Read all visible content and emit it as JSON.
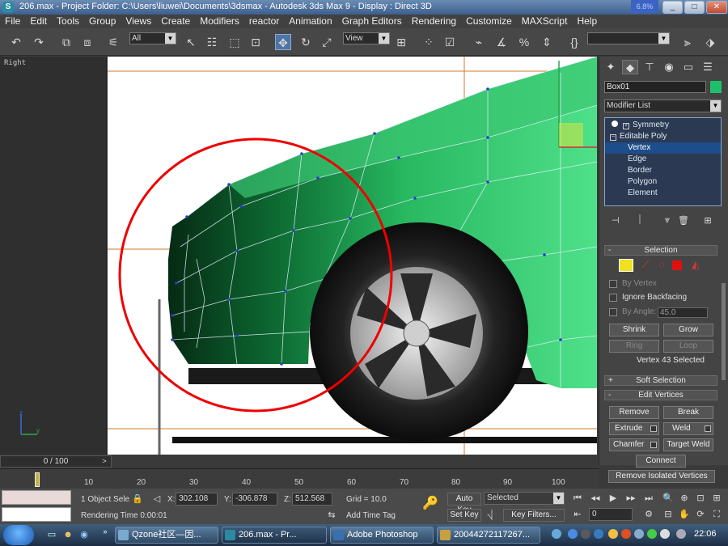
{
  "window": {
    "title": "206.max   - Project Folder: C:\\Users\\liuwei\\Documents\\3dsmax      - Autodesk 3ds Max 9      - Display : Direct 3D",
    "meter": "6.8%"
  },
  "menu": [
    "File",
    "Edit",
    "Tools",
    "Group",
    "Views",
    "Create",
    "Modifiers",
    "reactor",
    "Animation",
    "Graph Editors",
    "Rendering",
    "Customize",
    "MAXScript",
    "Help"
  ],
  "toolbar": {
    "selection_filter": "All",
    "reference_coord": "View",
    "named_selection": ""
  },
  "viewport": {
    "label": "Right"
  },
  "command_panel": {
    "object_name": "Box01",
    "object_color": "#1fc06a",
    "modifier_list": "Modifier List",
    "stack": [
      {
        "label": "Symmetry",
        "level": 0
      },
      {
        "label": "Editable Poly",
        "level": 0
      },
      {
        "label": "Vertex",
        "level": 1,
        "selected": true
      },
      {
        "label": "Edge",
        "level": 1
      },
      {
        "label": "Border",
        "level": 1
      },
      {
        "label": "Polygon",
        "level": 1
      },
      {
        "label": "Element",
        "level": 1
      }
    ],
    "selection": {
      "header": "Selection",
      "by_vertex": "By Vertex",
      "ignore_backfacing": "Ignore Backfacing",
      "by_angle": "By Angle:",
      "angle_value": "45.0",
      "shrink": "Shrink",
      "grow": "Grow",
      "ring": "Ring",
      "loop": "Loop",
      "status": "Vertex 43 Selected"
    },
    "soft_selection": "Soft Selection",
    "edit_vertices": {
      "header": "Edit Vertices",
      "remove": "Remove",
      "break": "Break",
      "extrude": "Extrude",
      "weld": "Weld",
      "chamfer": "Chamfer",
      "target_weld": "Target Weld",
      "connect": "Connect",
      "remove_isolated": "Remove Isolated Vertices"
    }
  },
  "timeline": {
    "slider": "0 / 100",
    "labels": [
      "10",
      "20",
      "30",
      "40",
      "50",
      "60",
      "70",
      "80",
      "90",
      "100"
    ]
  },
  "status": {
    "selection_count": "1 Object Sele",
    "prompt": "Rendering Time  0:00:01",
    "x_label": "X:",
    "x": "302.108",
    "y_label": "Y:",
    "y": "-306.878",
    "z_label": "Z:",
    "z": "512.568",
    "grid": "Grid = 10.0",
    "add_time_tag": "Add Time Tag",
    "auto_key": "Auto Key",
    "set_key": "Set Key",
    "key_mode": "Selected",
    "key_filters": "Key Filters...",
    "current_frame": "0"
  },
  "taskbar": {
    "tasks": [
      "Qzone社区—因...",
      "206.max    - Pr...",
      "Adobe Photoshop",
      "20044272117267..."
    ],
    "clock": "22:06"
  }
}
